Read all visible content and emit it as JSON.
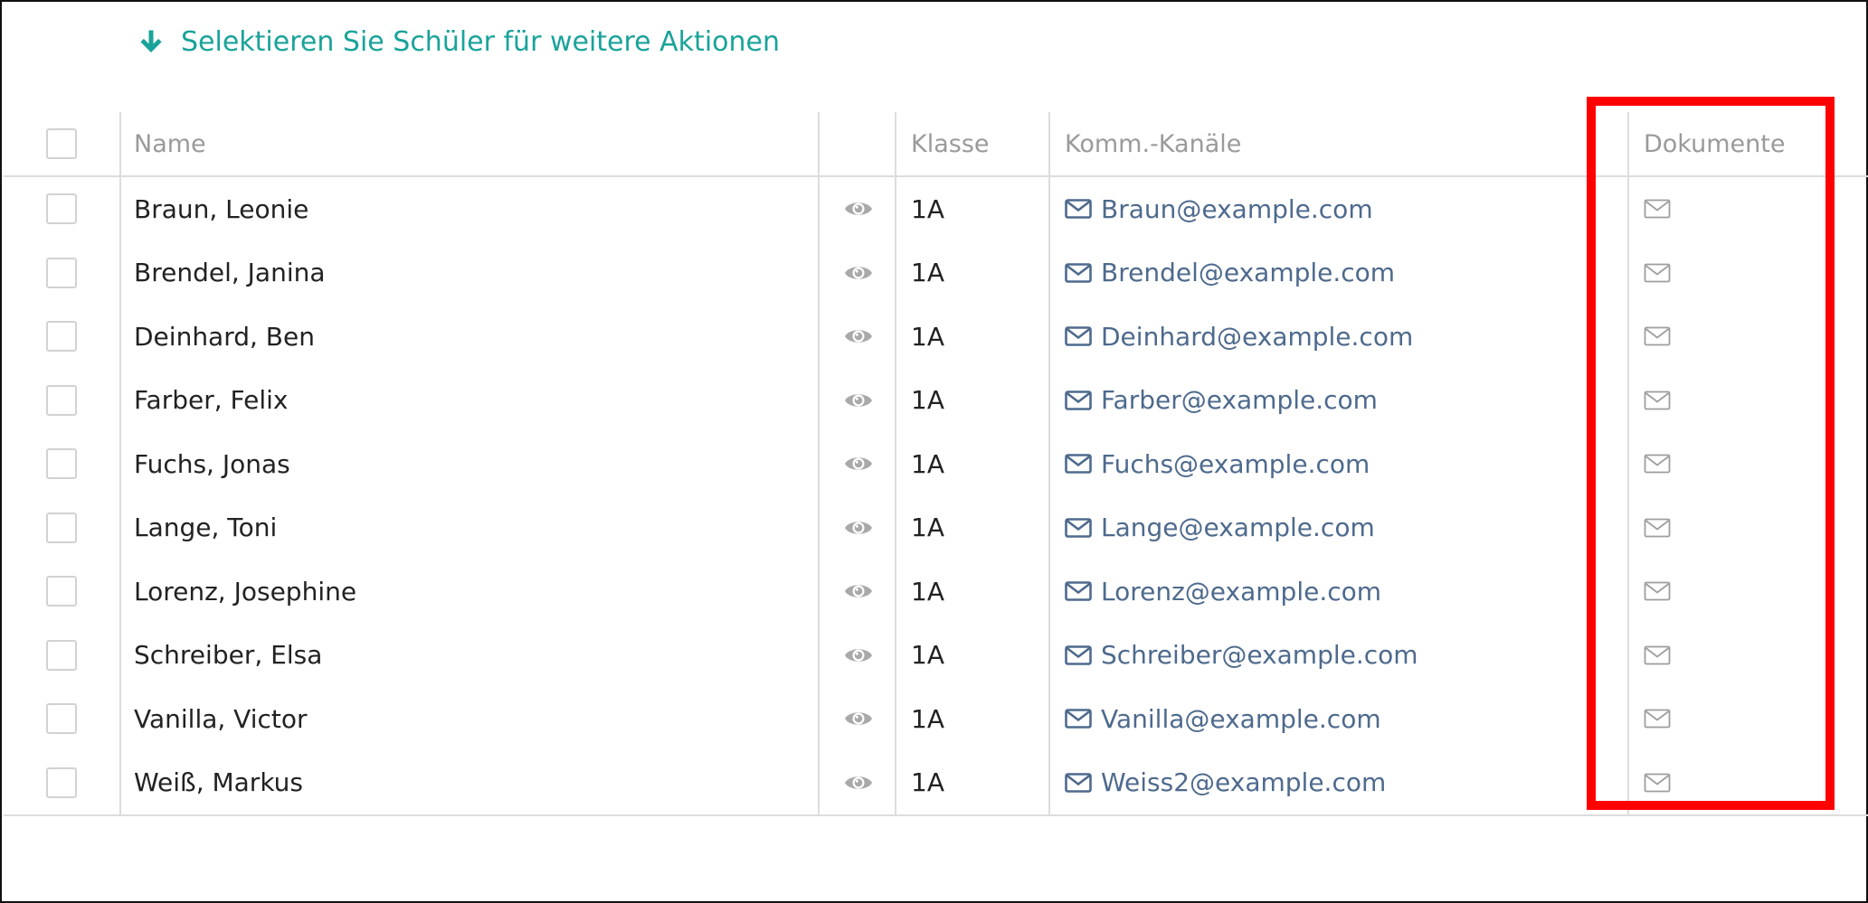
{
  "header": {
    "action_hint": "Selektieren Sie Schüler für weitere Aktionen"
  },
  "table": {
    "columns": {
      "name": "Name",
      "view": "",
      "klasse": "Klasse",
      "komm": "Komm.-Kanäle",
      "dokumente": "Dokumente"
    },
    "rows": [
      {
        "name": "Braun, Leonie",
        "klasse": "1A",
        "email": "Braun@example.com"
      },
      {
        "name": "Brendel, Janina",
        "klasse": "1A",
        "email": "Brendel@example.com"
      },
      {
        "name": "Deinhard, Ben",
        "klasse": "1A",
        "email": "Deinhard@example.com"
      },
      {
        "name": "Farber, Felix",
        "klasse": "1A",
        "email": "Farber@example.com"
      },
      {
        "name": "Fuchs, Jonas",
        "klasse": "1A",
        "email": "Fuchs@example.com"
      },
      {
        "name": "Lange, Toni",
        "klasse": "1A",
        "email": "Lange@example.com"
      },
      {
        "name": "Lorenz, Josephine",
        "klasse": "1A",
        "email": "Lorenz@example.com"
      },
      {
        "name": "Schreiber, Elsa",
        "klasse": "1A",
        "email": "Schreiber@example.com"
      },
      {
        "name": "Vanilla, Victor",
        "klasse": "1A",
        "email": "Vanilla@example.com"
      },
      {
        "name": "Weiß, Markus",
        "klasse": "1A",
        "email": "Weiss2@example.com"
      }
    ]
  },
  "icons": {
    "action_hint": "arrow-down-icon",
    "view": "eye-icon",
    "komm": "envelope-icon",
    "dokumente": "envelope-outline-icon"
  },
  "colors": {
    "accent": "#1aa39a",
    "link": "#4e6a8d",
    "highlight": "#ff0000"
  }
}
